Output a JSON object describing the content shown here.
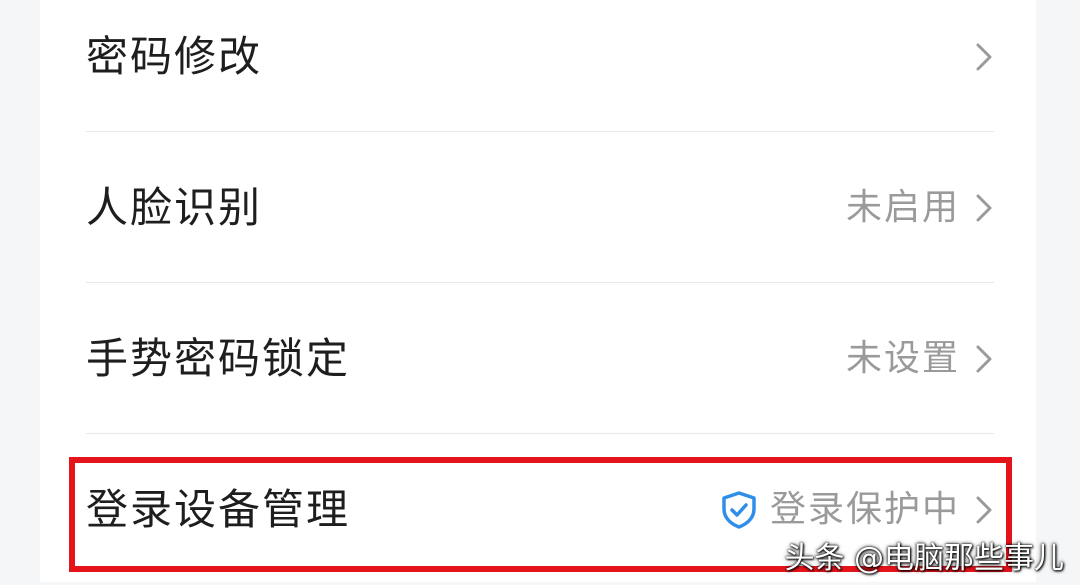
{
  "settings": {
    "items": [
      {
        "label": "密码修改",
        "status": ""
      },
      {
        "label": "人脸识别",
        "status": "未启用"
      },
      {
        "label": "手势密码锁定",
        "status": "未设置"
      },
      {
        "label": "登录设备管理",
        "status": "登录保护中"
      }
    ]
  },
  "watermark": {
    "text": "头条 @电脑那些事儿"
  },
  "colors": {
    "highlight": "#e5141b",
    "shield": "#2f8fe8",
    "status_text": "#9a9a9a",
    "label_text": "#1e1e1e"
  }
}
